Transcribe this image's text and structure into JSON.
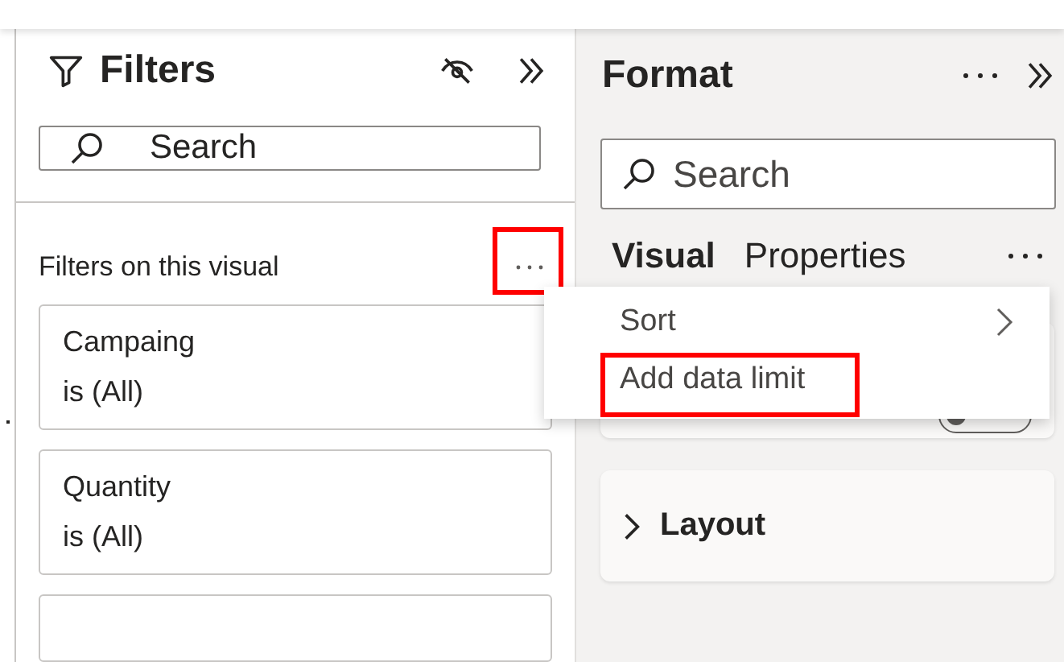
{
  "filters_pane": {
    "title": "Filters",
    "search": {
      "placeholder": "Search"
    },
    "section_label": "Filters on this visual",
    "more_highlighted": true,
    "filter_cards": [
      {
        "field": "Campaing",
        "condition": "is (All)"
      },
      {
        "field": "Quantity",
        "condition": "is (All)"
      }
    ]
  },
  "format_pane": {
    "title": "Format",
    "search": {
      "placeholder": "Search"
    },
    "tabs": [
      {
        "label": "Visual",
        "selected": true
      },
      {
        "label": "Properties",
        "selected": false
      }
    ],
    "sections": [
      {
        "kind": "toggle",
        "on": false
      },
      {
        "kind": "plain",
        "label": "Layout"
      }
    ]
  },
  "context_menu": {
    "items": [
      {
        "label": "Sort",
        "submenu": true,
        "highlighted": false
      },
      {
        "label": "Add data limit",
        "submenu": false,
        "highlighted": true
      }
    ]
  }
}
